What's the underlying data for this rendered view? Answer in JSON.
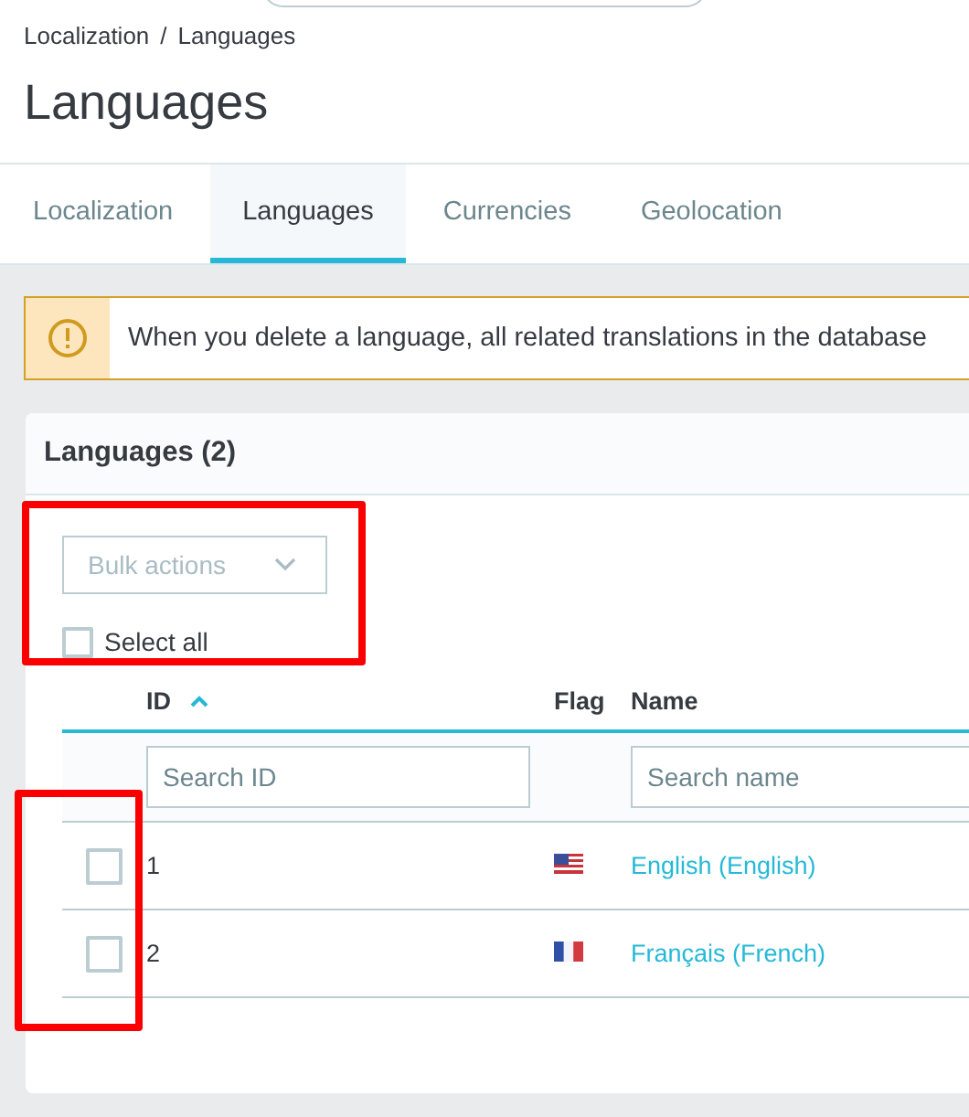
{
  "breadcrumb": {
    "items": [
      "Localization",
      "Languages"
    ],
    "separator": "/"
  },
  "title": "Languages",
  "tabs": [
    {
      "label": "Localization",
      "selected": false
    },
    {
      "label": "Languages",
      "selected": true
    },
    {
      "label": "Currencies",
      "selected": false
    },
    {
      "label": "Geolocation",
      "selected": false
    }
  ],
  "alert": {
    "text": "When you delete a language, all related translations in the database"
  },
  "card": {
    "title": "Languages (2)",
    "bulk_actions": {
      "label": "Bulk actions",
      "disabled": true
    },
    "select_all": {
      "label": "Select all",
      "checked": false
    },
    "table": {
      "columns": [
        {
          "label": "ID",
          "sorted": true
        },
        {
          "label": "Flag",
          "sorted": false
        },
        {
          "label": "Name",
          "sorted": false
        }
      ],
      "filters": [
        {
          "placeholder": "Search ID"
        },
        {
          "placeholder": "Search name"
        }
      ],
      "rows": [
        {
          "checked": false,
          "id": "1",
          "kind": "us",
          "name": "English (English)"
        },
        {
          "checked": false,
          "id": "2",
          "kind": "fr",
          "name": "Français (French)"
        }
      ]
    }
  }
}
